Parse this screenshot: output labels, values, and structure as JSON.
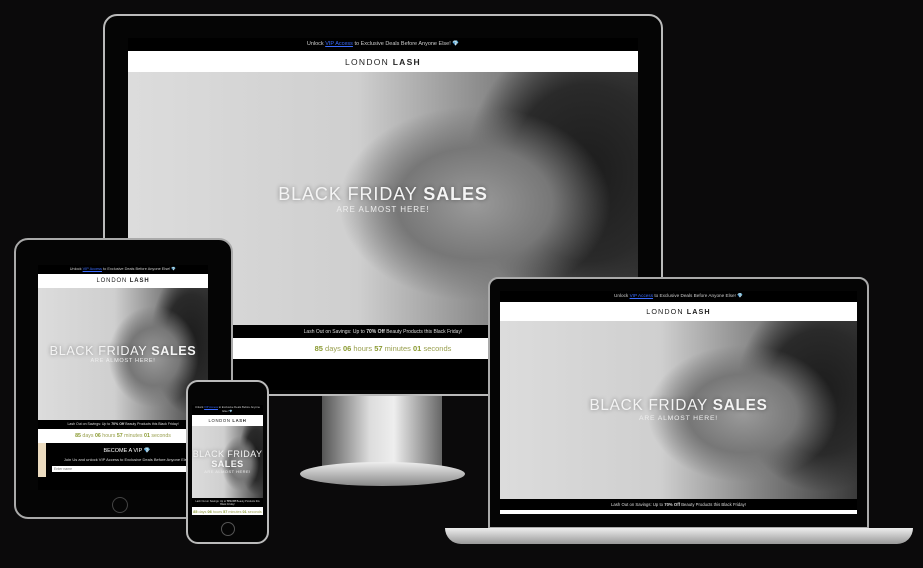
{
  "site": {
    "banner": {
      "pre": "Unlock ",
      "link": "VIP Access",
      "post": " to Exclusive Deals Before Anyone Else! 💎"
    },
    "brand": {
      "light": "LONDON ",
      "bold": "LASH"
    },
    "hero": {
      "title_light": "BLACK FRIDAY ",
      "title_bold": "SALES",
      "subtitle": "ARE ALMOST HERE!"
    },
    "promo": {
      "pre": "Lash Out on Savings: Up to ",
      "bold": "70% Off",
      "post": " Beauty Products this Black Friday!"
    },
    "countdown": {
      "days": "85",
      "days_label": " days ",
      "hours": "06",
      "hours_label": " hours ",
      "minutes": "57",
      "minutes_label": " minutes ",
      "seconds": "01",
      "seconds_label": " seconds"
    },
    "vip": {
      "title": "BECOME A VIP 💎",
      "text": "Join Us and unlock VIP Access to Exclusive Deals Before Anyone Else!",
      "placeholder": "Enter name"
    }
  },
  "devices": [
    "desktop-monitor",
    "tablet",
    "phone",
    "laptop"
  ]
}
